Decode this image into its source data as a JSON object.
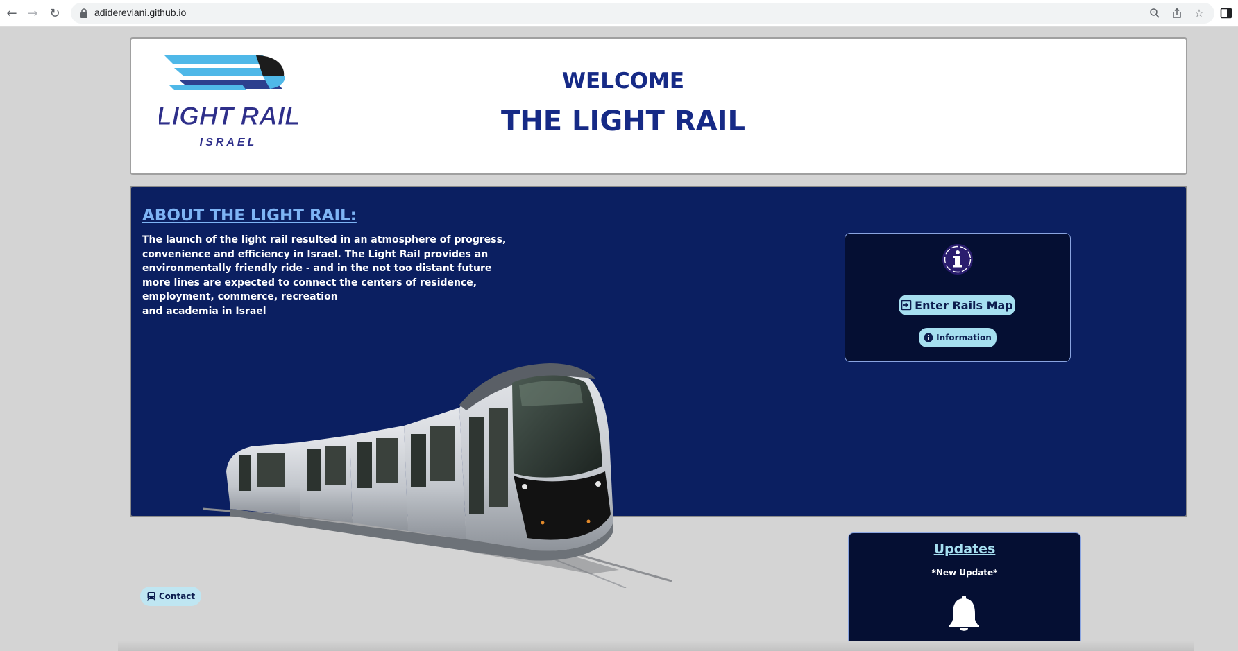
{
  "browser": {
    "url": "adidereviani.github.io",
    "back_icon": "arrow-left-icon",
    "forward_icon": "arrow-right-icon",
    "reload_icon": "reload-icon",
    "lock_icon": "lock-icon",
    "zoom_icon": "zoom-icon",
    "share_icon": "share-icon",
    "bookmark_icon": "star-icon",
    "side_panel_icon": "side-panel-icon"
  },
  "header": {
    "logo_text": "LIGHT RAIL",
    "logo_subtext": "ISRAEL",
    "welcome": "WELCOME",
    "title": "THE LIGHT RAIL"
  },
  "about": {
    "heading": "ABOUT THE LIGHT RAIL:",
    "lines": [
      "The launch of the light rail resulted in an atmosphere of progress,",
      "convenience and efficiency in Israel. The Light Rail provides an",
      "environmentally friendly ride - and in the not too distant future",
      "more lines are expected to connect the centers of residence,",
      "employment, commerce, recreation",
      "and academia in Israel"
    ]
  },
  "info_box": {
    "icon": "info-icon",
    "rails_map_label": "Enter Rails Map",
    "information_label": "Information"
  },
  "contact": {
    "label": "Contact"
  },
  "updates": {
    "title": "Updates",
    "subtitle": "*New Update*",
    "icon": "bell-icon"
  },
  "colors": {
    "page_bg": "#d4d4d4",
    "header_text": "#162a86",
    "about_bg": "#0b1f61",
    "box_bg": "#050f33",
    "button_bg": "#a6dff0",
    "link_blue": "#7eb4f4"
  }
}
